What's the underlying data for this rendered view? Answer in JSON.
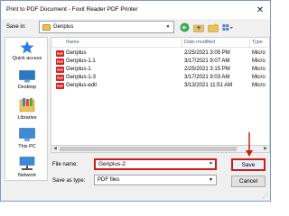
{
  "window": {
    "title": "Print to PDF Document - Foxit Reader PDF Printer",
    "close_icon": "close-icon"
  },
  "save_in": {
    "label": "Save in:",
    "value": "Genplus"
  },
  "toolbar": {
    "icons": [
      "back-icon",
      "up-folder-icon",
      "new-folder-icon",
      "view-menu-icon"
    ]
  },
  "places": [
    {
      "label": "Quick access",
      "icon": "star-icon"
    },
    {
      "label": "Desktop",
      "icon": "desktop-icon"
    },
    {
      "label": "Libraries",
      "icon": "libraries-icon"
    },
    {
      "label": "This PC",
      "icon": "computer-icon"
    },
    {
      "label": "Network",
      "icon": "network-icon"
    }
  ],
  "file_list": {
    "columns": [
      "Name",
      "Date modified",
      "Type"
    ],
    "files": [
      {
        "name": "Genplus",
        "date": "2/25/2021 3:05 PM",
        "type": "Micro"
      },
      {
        "name": "Genplus-1.1",
        "date": "3/17/2021 9:07 AM",
        "type": "Micro"
      },
      {
        "name": "Genplus-1",
        "date": "2/25/2021 3:15 PM",
        "type": "Micro"
      },
      {
        "name": "Genplus-1-3",
        "date": "3/17/2021 9:03 AM",
        "type": "Micro"
      },
      {
        "name": "Genplus-edit",
        "date": "3/13/2021 11:51 AM",
        "type": "Micro"
      }
    ],
    "file_icon": "PDF"
  },
  "file_name": {
    "label": "File name:",
    "value": "Genplus-2"
  },
  "save_as_type": {
    "label": "Save as type:",
    "value": "PDF files"
  },
  "buttons": {
    "save": "Save",
    "cancel": "Cancel"
  },
  "colors": {
    "highlight": "#d21a1a",
    "pdf_icon": "#d71f26",
    "folder": "#e8c25a"
  }
}
